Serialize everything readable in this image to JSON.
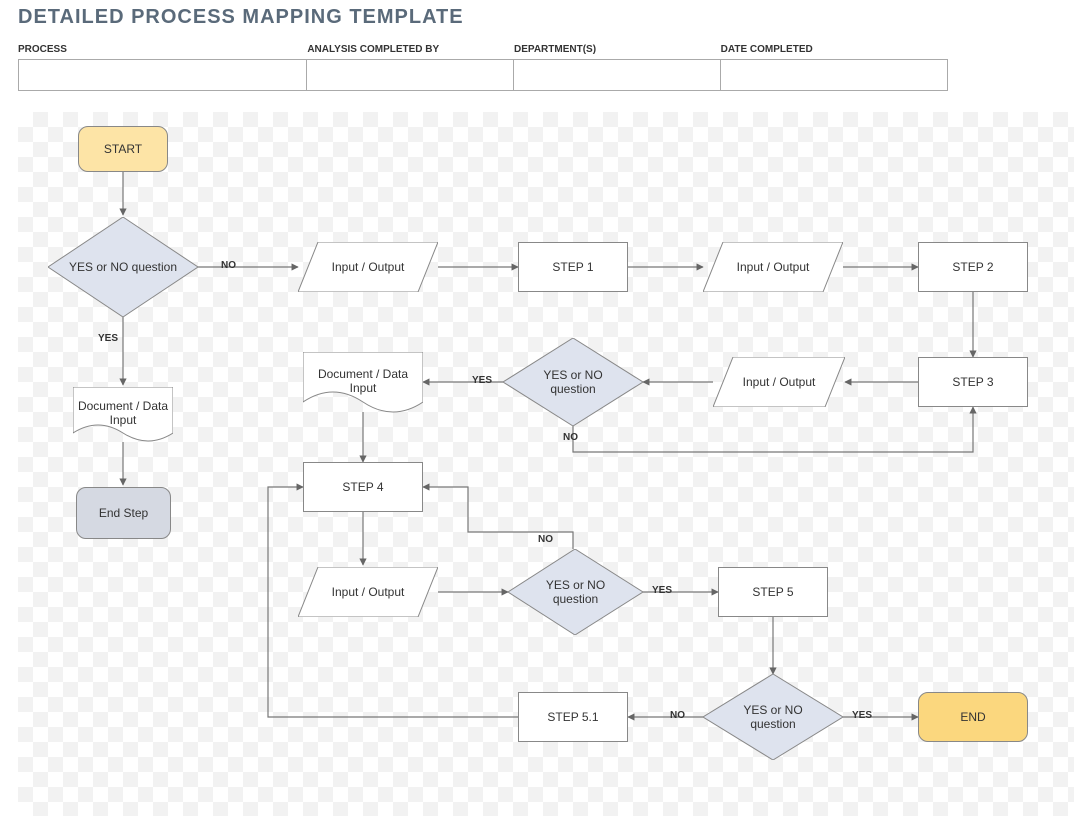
{
  "title": "DETAILED PROCESS MAPPING TEMPLATE",
  "header": {
    "process_label": "PROCESS",
    "analysis_label": "ANALYSIS COMPLETED BY",
    "department_label": "DEPARTMENT(S)",
    "date_label": "DATE COMPLETED",
    "process": "",
    "analysis": "",
    "department": "",
    "date": ""
  },
  "nodes": {
    "start": "START",
    "q1": "YES or NO question",
    "q1_yes": "YES",
    "q1_no": "NO",
    "doc1": "Document / Data Input",
    "endstep": "End Step",
    "io1": "Input / Output",
    "step1": "STEP 1",
    "io2": "Input / Output",
    "step2": "STEP 2",
    "step3": "STEP 3",
    "io3": "Input / Output",
    "q2": "YES or NO question",
    "q2_yes": "YES",
    "q2_no": "NO",
    "doc2": "Document / Data Input",
    "step4": "STEP 4",
    "io4": "Input / Output",
    "q3": "YES or NO question",
    "q3_yes": "YES",
    "q3_no": "NO",
    "step5": "STEP 5",
    "q4": "YES or NO question",
    "q4_yes": "YES",
    "q4_no": "NO",
    "step51": "STEP 5.1",
    "end": "END"
  }
}
